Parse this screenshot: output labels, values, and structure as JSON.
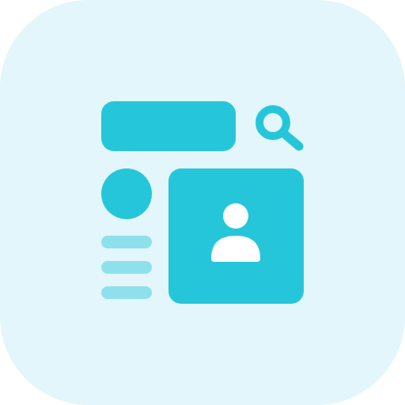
{
  "icon": {
    "name": "profile-search-icon",
    "colors": {
      "background": "#e2f6fb",
      "primary": "#26c6da",
      "secondary": "#8ee0ec",
      "foreground": "#ffffff"
    },
    "parts": [
      "search-bar",
      "search-icon",
      "avatar-circle",
      "text-lines",
      "profile-card",
      "user-icon"
    ]
  }
}
